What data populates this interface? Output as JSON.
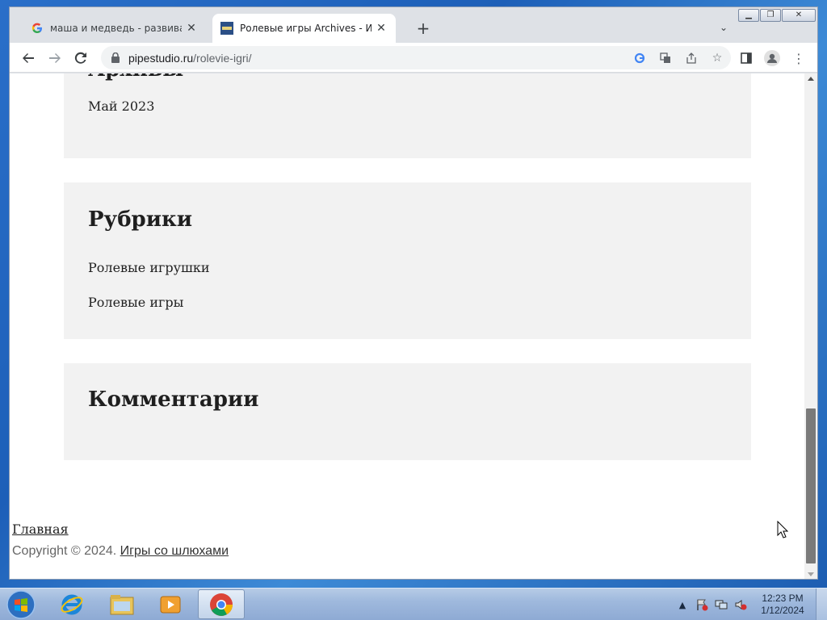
{
  "browser": {
    "tabs": [
      {
        "title": "маша и медведь - развивающие",
        "favicon": "google-g-icon",
        "active": false
      },
      {
        "title": "Ролевые игры Archives - Игры с",
        "favicon": "pipestudio-favicon",
        "active": true
      }
    ],
    "new_tab_label": "+",
    "url_host": "pipestudio.ru",
    "url_path": "/rolevie-igri/"
  },
  "page": {
    "archives": {
      "heading": "Архивы",
      "items": [
        "Май 2023"
      ]
    },
    "categories": {
      "heading": "Рубрики",
      "items": [
        "Ролевые игрушки",
        "Ролевые игры"
      ]
    },
    "comments": {
      "heading": "Комментарии"
    },
    "footer": {
      "nav_link": "Главная",
      "copyright_prefix": "Copyright © 2024.",
      "site_link": "Игры со шлюхами"
    }
  },
  "taskbar": {
    "apps": [
      "internet-explorer-icon",
      "file-explorer-icon",
      "media-player-icon",
      "chrome-icon"
    ],
    "time": "12:23 PM",
    "date": "1/12/2024"
  },
  "colors": {
    "widget_bg": "#f2f2f2",
    "scroll_thumb": "#7a7a7a",
    "tab_bar": "#dee1e6"
  }
}
